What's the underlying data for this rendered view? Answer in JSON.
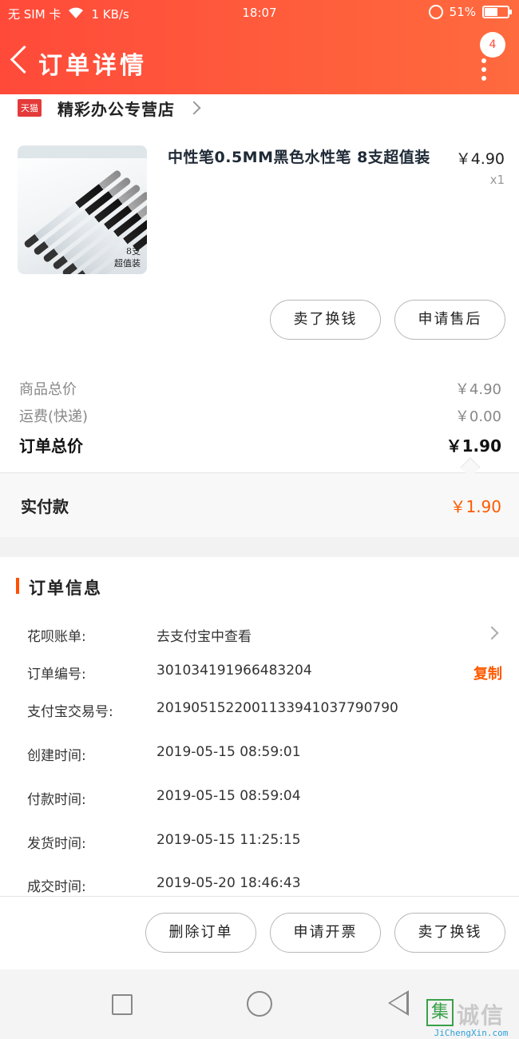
{
  "status_bar": {
    "carrier": "无 SIM 卡",
    "speed": "1 KB/s",
    "time": "18:07",
    "battery": "51%"
  },
  "header": {
    "title": "订单详情",
    "badge": "4",
    "colors": {
      "bg": "#ff4a3a",
      "accent": "#ff5a00"
    }
  },
  "store": {
    "platform_tag": "天猫",
    "name": "精彩办公专营店"
  },
  "product": {
    "name": "中性笔0.5MM黑色水性笔 8支超值装",
    "price": "￥4.90",
    "quantity": "x1",
    "thumb_caption_1": "8支",
    "thumb_caption_2": "超值装"
  },
  "product_actions": {
    "exchange": "卖了换钱",
    "after_sale": "申请售后"
  },
  "summary": {
    "goods_total_label": "商品总价",
    "goods_total_value": "￥4.90",
    "shipping_label": "运费(快递)",
    "shipping_value": "￥0.00",
    "order_total_label": "订单总价",
    "order_total_value": "￥1.90",
    "paid_label": "实付款",
    "paid_value": "￥1.90"
  },
  "order_info": {
    "title": "订单信息",
    "rows": [
      {
        "label": "花呗账单:",
        "value": "去支付宝中查看"
      },
      {
        "label": "订单编号:",
        "value": "301034191966483204",
        "action": "复制"
      },
      {
        "label": "支付宝交易号:",
        "value": "2019051522001133941037790790"
      },
      {
        "label": "创建时间:",
        "value": "2019-05-15 08:59:01"
      },
      {
        "label": "付款时间:",
        "value": "2019-05-15 08:59:04"
      },
      {
        "label": "发货时间:",
        "value": "2019-05-15 11:25:15"
      },
      {
        "label": "成交时间:",
        "value": "2019-05-20 18:46:43"
      }
    ]
  },
  "bottom_actions": {
    "delete": "删除订单",
    "invoice": "申请开票",
    "exchange": "卖了换钱"
  },
  "watermark": {
    "logo": "集",
    "text_cn": "诚信",
    "text_en": "JiChengXin.com"
  }
}
